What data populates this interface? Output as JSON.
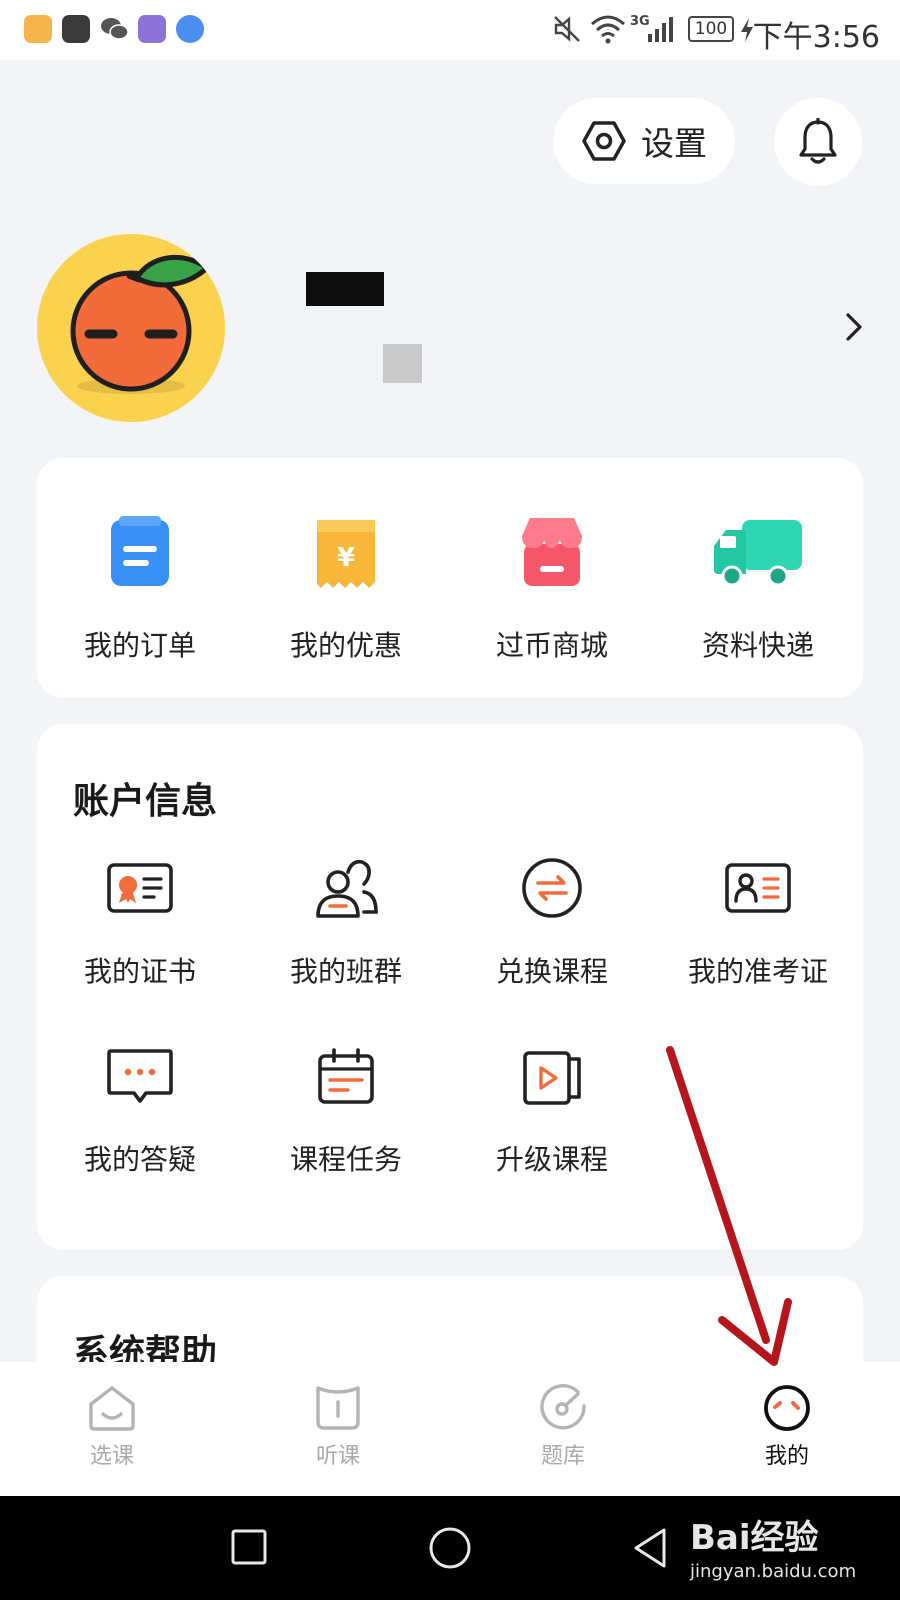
{
  "status_bar": {
    "time": "下午3:56",
    "network": "3G",
    "battery": "100"
  },
  "header": {
    "settings_label": "设置"
  },
  "quick_actions": [
    {
      "label": "我的订单",
      "icon": "order-icon"
    },
    {
      "label": "我的优惠",
      "icon": "coupon-icon"
    },
    {
      "label": "过币商城",
      "icon": "store-icon"
    },
    {
      "label": "资料快递",
      "icon": "delivery-truck-icon"
    }
  ],
  "account": {
    "title": "账户信息",
    "items": [
      {
        "label": "我的证书",
        "icon": "certificate-icon"
      },
      {
        "label": "我的班群",
        "icon": "class-group-icon"
      },
      {
        "label": "兑换课程",
        "icon": "exchange-icon"
      },
      {
        "label": "我的准考证",
        "icon": "admission-ticket-icon"
      },
      {
        "label": "我的答疑",
        "icon": "qa-chat-icon"
      },
      {
        "label": "课程任务",
        "icon": "calendar-task-icon"
      },
      {
        "label": "升级课程",
        "icon": "upgrade-video-icon"
      }
    ]
  },
  "help": {
    "title": "系统帮助"
  },
  "tabs": [
    {
      "label": "选课",
      "icon": "select-course-icon",
      "active": false
    },
    {
      "label": "听课",
      "icon": "listen-course-icon",
      "active": false
    },
    {
      "label": "题库",
      "icon": "question-bank-icon",
      "active": false
    },
    {
      "label": "我的",
      "icon": "profile-face-icon",
      "active": true
    }
  ],
  "watermark": {
    "title": "Bai经验",
    "url": "jingyan.baidu.com"
  },
  "colors": {
    "accent": "#f26b3a",
    "background": "#f3f4f8",
    "avatar_bg": "#fbd24e",
    "annotation_arrow": "#b5151b"
  }
}
